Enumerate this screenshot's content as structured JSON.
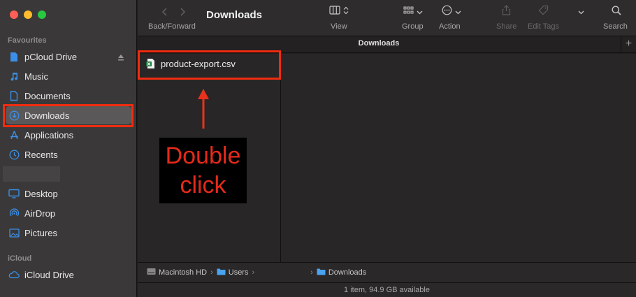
{
  "sidebar": {
    "favourites_header": "Favourites",
    "icloud_header": "iCloud",
    "items": [
      {
        "label": "pCloud Drive",
        "icon": "document-icon"
      },
      {
        "label": "Music",
        "icon": "music-icon"
      },
      {
        "label": "Documents",
        "icon": "document-icon"
      },
      {
        "label": "Downloads",
        "icon": "download-icon"
      },
      {
        "label": "Applications",
        "icon": "applications-icon"
      },
      {
        "label": "Recents",
        "icon": "clock-icon"
      },
      {
        "label": "Desktop",
        "icon": "desktop-icon"
      },
      {
        "label": "AirDrop",
        "icon": "airdrop-icon"
      },
      {
        "label": "Pictures",
        "icon": "pictures-icon"
      },
      {
        "label": "iCloud Drive",
        "icon": "cloud-icon"
      }
    ]
  },
  "toolbar": {
    "title": "Downloads",
    "back_forward_label": "Back/Forward",
    "view_label": "View",
    "group_label": "Group",
    "action_label": "Action",
    "share_label": "Share",
    "edit_tags_label": "Edit Tags",
    "search_label": "Search"
  },
  "tab": {
    "title": "Downloads",
    "plus": "+"
  },
  "files": [
    {
      "name": "product-export.csv",
      "icon": "csv-file-icon"
    }
  ],
  "annotation": {
    "line1": "Double",
    "line2": "click"
  },
  "pathbar": {
    "segments": [
      "Macintosh HD",
      "Users",
      "Downloads"
    ],
    "separator": "›"
  },
  "status": "1 item, 94.9 GB available",
  "colors": {
    "accent": "#3b8fe6",
    "highlight": "#f02c10",
    "annotation_text": "#e52a1a"
  }
}
